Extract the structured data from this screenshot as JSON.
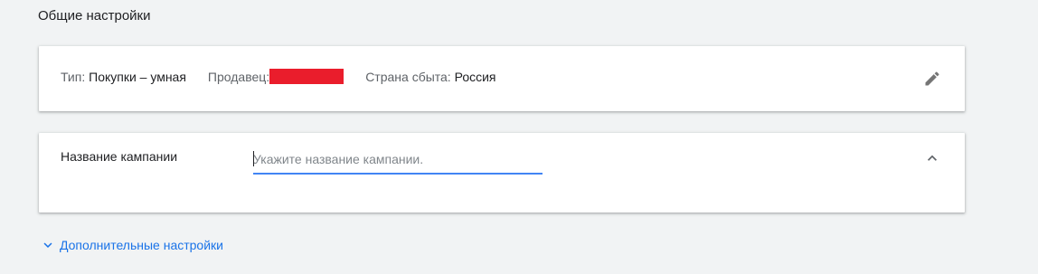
{
  "section": {
    "title": "Общие настройки"
  },
  "summary": {
    "type_label": "Тип:",
    "type_value": "Покупки – умная",
    "seller_label": "Продавец:",
    "country_label": "Страна сбыта:",
    "country_value": "Россия",
    "edit_icon": "pencil-icon",
    "redaction_color": "#ea1d2c"
  },
  "campaign_name": {
    "label": "Название кампании",
    "value": "",
    "placeholder": "Укажите название кампании.",
    "collapse_icon": "chevron-up-icon",
    "underline_color": "#4285f4"
  },
  "more_settings": {
    "label": "Дополнительные настройки",
    "icon": "chevron-down-icon",
    "link_color": "#1a73e8"
  }
}
